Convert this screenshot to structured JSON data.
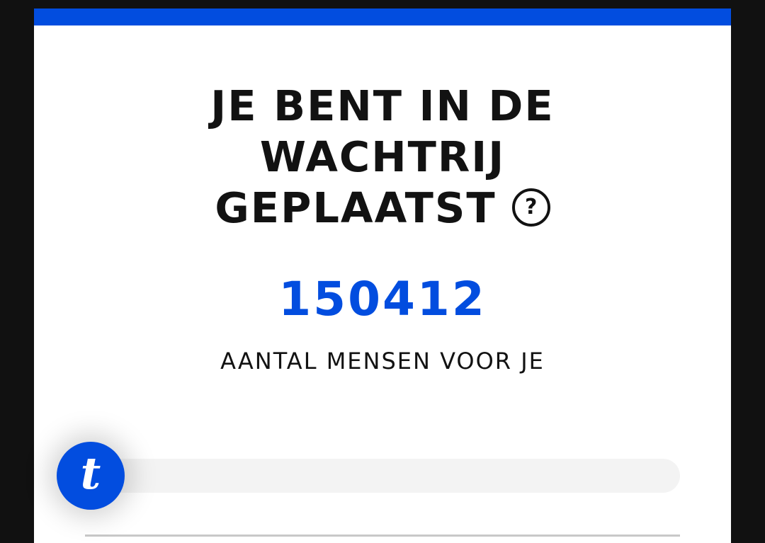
{
  "queue": {
    "title_lines": [
      "JE BENT IN DE",
      "WACHTRIJ",
      "GEPLAATST"
    ],
    "help_icon": "question-circle-icon",
    "help_glyph": "?",
    "people_ahead": "150412",
    "people_ahead_label": "AANTAL MENSEN VOOR JE",
    "progress_fraction": 0.0
  },
  "brand": {
    "logo_letter": "t",
    "accent_color": "#024ddf"
  }
}
